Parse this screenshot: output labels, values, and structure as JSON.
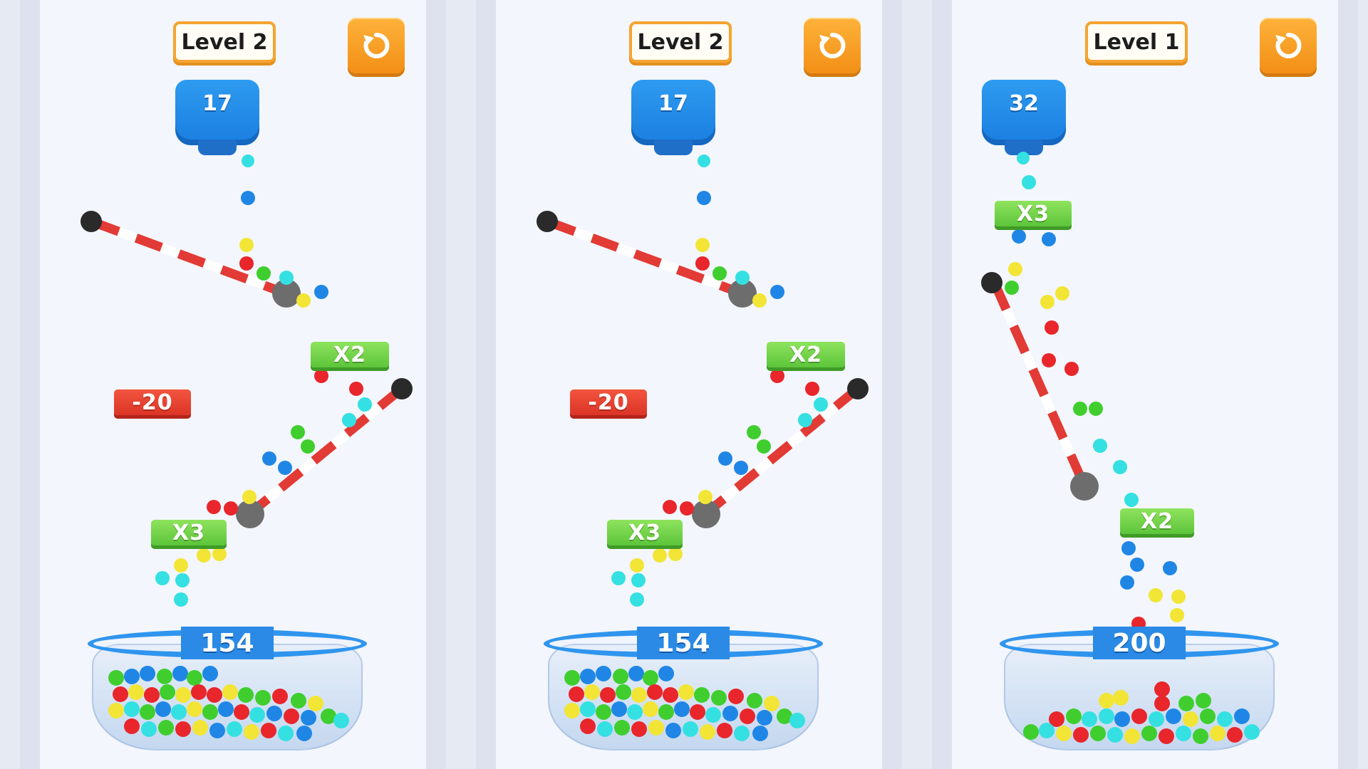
{
  "screens": [
    {
      "level_label": "Level 2",
      "dispenser_count": "17",
      "basket_count": "154",
      "gates": [
        {
          "label": "X2",
          "color": "green"
        },
        {
          "label": "-20",
          "color": "red"
        },
        {
          "label": "X3",
          "color": "green"
        }
      ]
    },
    {
      "level_label": "Level 2",
      "dispenser_count": "17",
      "basket_count": "154",
      "gates": [
        {
          "label": "X2",
          "color": "green"
        },
        {
          "label": "-20",
          "color": "red"
        },
        {
          "label": "X3",
          "color": "green"
        }
      ]
    },
    {
      "level_label": "Level 1",
      "dispenser_count": "32",
      "basket_count": "200",
      "gates": [
        {
          "label": "X3",
          "color": "green"
        },
        {
          "label": "X2",
          "color": "green"
        }
      ]
    }
  ],
  "icons": {
    "restart": "restart-icon"
  },
  "colors": {
    "ball_red": "#e8262b",
    "ball_green": "#3fce2e",
    "ball_blue": "#1f86e6",
    "ball_yellow": "#f2e535",
    "ball_cyan": "#34e0e2",
    "accent_orange": "#f7a024",
    "gate_green": "#6fd447",
    "gate_red": "#e8412f"
  }
}
